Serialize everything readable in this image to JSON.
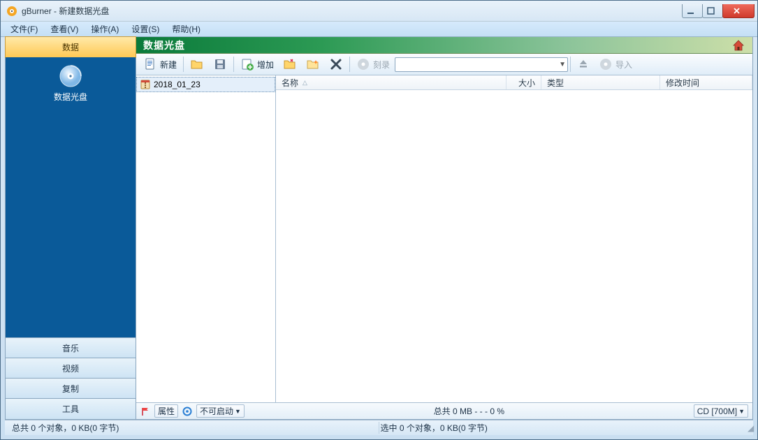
{
  "window": {
    "title": "gBurner - 新建数据光盘"
  },
  "menu": {
    "file": "文件(F)",
    "view": "查看(V)",
    "action": "操作(A)",
    "settings": "设置(S)",
    "help": "帮助(H)"
  },
  "sidebar": {
    "data": "数据",
    "music": "音乐",
    "video": "视频",
    "copy": "复制",
    "tools": "工具",
    "panel_label": "数据光盘"
  },
  "header": {
    "title": "数据光盘"
  },
  "toolbar": {
    "new": "新建",
    "add": "增加",
    "burn": "刻录",
    "import": "导入",
    "drive_selected": ""
  },
  "tree": {
    "root": "2018_01_23"
  },
  "columns": {
    "name": "名称",
    "size": "大小",
    "type": "类型",
    "mtime": "修改时间"
  },
  "ws_status": {
    "properties": "属性",
    "bootable": "不可启动",
    "total": "总共  0 MB   - - -   0 %",
    "media": "CD [700M]"
  },
  "status": {
    "left": "总共 0 个对象，0 KB(0 字节)",
    "right": "选中 0 个对象，0 KB(0 字节)"
  },
  "colors": {
    "accent_green": "#0a7a3a",
    "accent_orange": "#ffc955",
    "sidebar_blue": "#0a5a99"
  }
}
